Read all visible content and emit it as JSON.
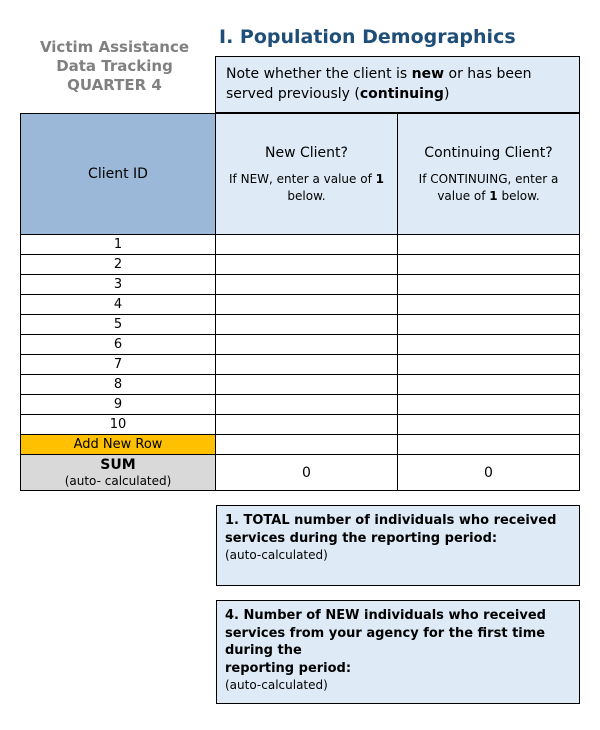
{
  "header": {
    "doc_title_line1": "Victim Assistance",
    "doc_title_line2": "Data Tracking",
    "doc_title_line3": "QUARTER 4",
    "section_title": "I.   Population Demographics",
    "note_pre": "Note whether the client is ",
    "note_bold1": "new",
    "note_mid": " or has been served previously (",
    "note_bold2": "continuing",
    "note_post": ")"
  },
  "table": {
    "col1_header": "Client ID",
    "col2_question": "New Client?",
    "col2_sub_pre": "If NEW, enter a value of ",
    "col2_sub_bold": "1",
    "col2_sub_post": " below.",
    "col3_question": "Continuing Client?",
    "col3_sub_pre": "If CONTINUING, enter a value of ",
    "col3_sub_bold": "1",
    "col3_sub_post": " below.",
    "rows": [
      "1",
      "2",
      "3",
      "4",
      "5",
      "6",
      "7",
      "8",
      "9",
      "10"
    ],
    "add_row_label": "Add New Row",
    "sum_label_bold": "SUM",
    "sum_label_sub": "(auto- calculated)",
    "sum_new": "0",
    "sum_cont": "0"
  },
  "box1": {
    "num": "1.  ",
    "text": "TOTAL number of individuals who received services during the reporting period:",
    "auto": "(auto-calculated)"
  },
  "box4": {
    "num": "4.  ",
    "text": "Number of NEW individuals who received services from your agency for the first time during the",
    "period": "reporting period:",
    "auto": "(auto-calculated)"
  }
}
